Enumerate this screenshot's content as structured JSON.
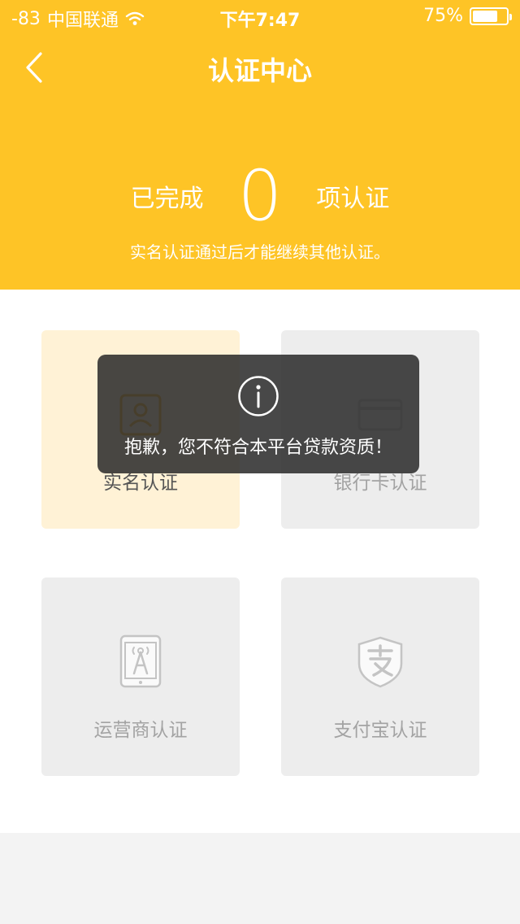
{
  "status_bar": {
    "signal": "-83",
    "carrier": "中国联通",
    "time": "下午7:47",
    "battery_percent": "75%",
    "battery_level": 0.75
  },
  "nav": {
    "title": "认证中心"
  },
  "summary": {
    "prefix": "已完成",
    "count": "0",
    "suffix": "项认证",
    "hint": "实名认证通过后才能继续其他认证。"
  },
  "cards": [
    {
      "label": "实名认证",
      "state": "active",
      "icon": "id-card-icon"
    },
    {
      "label": "银行卡认证",
      "state": "disabled",
      "icon": "bank-card-icon"
    },
    {
      "label": "运营商认证",
      "state": "disabled",
      "icon": "carrier-phone-icon"
    },
    {
      "label": "支付宝认证",
      "state": "disabled",
      "icon": "alipay-icon"
    }
  ],
  "toast": {
    "message": "抱歉，您不符合本平台贷款资质！",
    "icon": "info-icon"
  },
  "colors": {
    "brand_yellow": "#fec426",
    "active_card_bg": "#fff2d6",
    "disabled_card_bg": "#ededed"
  }
}
